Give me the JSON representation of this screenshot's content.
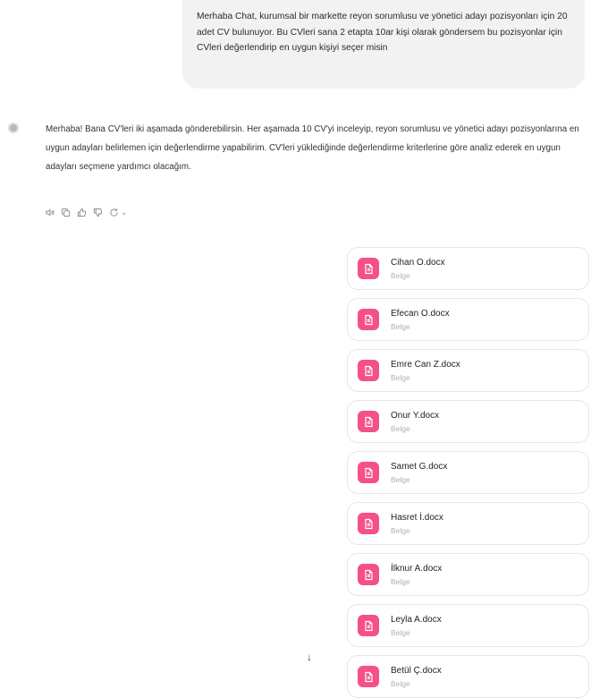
{
  "user_message": {
    "text": "Merhaba Chat, kurumsal bir markette reyon sorumlusu ve yönetici adayı pozisyonları için 20 adet CV bulunuyor. Bu CVleri sana 2 etapta 10ar kişi olarak göndersem bu pozisyonlar için CVleri değerlendirip en uygun kişiyi seçer misin"
  },
  "assistant_message": {
    "text": "Merhaba! Bana CV'leri iki aşamada gönderebilirsin. Her aşamada 10 CV'yi inceleyip, reyon sorumlusu ve yönetici adayı pozisyonlarına en uygun adayları belirlemen için değerlendirme yapabilirim. CV'leri yüklediğinde değerlendirme kriterlerine göre analiz ederek en uygun adayları seçmene yardımcı olacağım.",
    "actions": [
      {
        "name": "read-aloud-icon"
      },
      {
        "name": "copy-icon"
      },
      {
        "name": "thumbs-up-icon"
      },
      {
        "name": "thumbs-down-icon"
      },
      {
        "name": "regenerate-icon"
      }
    ],
    "regenerate_caret": "⌄"
  },
  "files": [
    {
      "name": "Cihan O.docx",
      "type": "Belge"
    },
    {
      "name": "Efecan O.docx",
      "type": "Belge"
    },
    {
      "name": "Emre Can Z.docx",
      "type": "Belge"
    },
    {
      "name": "Onur Y.docx",
      "type": "Belge"
    },
    {
      "name": "Samet G.docx",
      "type": "Belge"
    },
    {
      "name": "Hasret İ.docx",
      "type": "Belge"
    },
    {
      "name": "İlknur A.docx",
      "type": "Belge"
    },
    {
      "name": "Leyla A.docx",
      "type": "Belge"
    },
    {
      "name": "Betül Ç.docx",
      "type": "Belge"
    }
  ],
  "scroll_button": {
    "glyph": "↓",
    "icon": "arrow-down-icon"
  },
  "colors": {
    "file_icon": "#f5508a",
    "bubble": "#f2f2f2"
  }
}
